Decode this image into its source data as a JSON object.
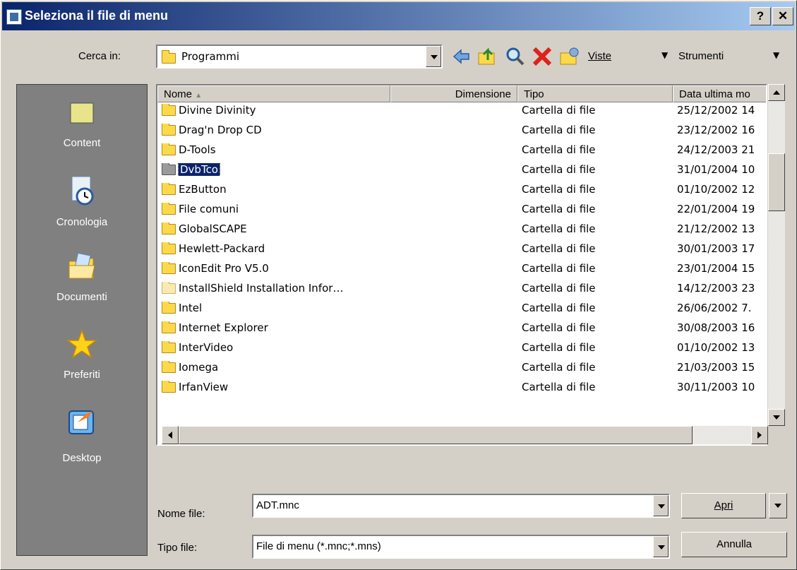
{
  "window": {
    "title": "Seleziona il file di menu",
    "help_label": "?",
    "close_label": "✕"
  },
  "toolbar": {
    "look_in_label": "Cerca in:",
    "look_in_value": "Programmi",
    "views_label": "Viste",
    "tools_label": "Strumenti"
  },
  "sidebar": {
    "items": [
      {
        "label": "Content",
        "icon": "folder-icon"
      },
      {
        "label": "Cronologia",
        "icon": "history-icon"
      },
      {
        "label": "Documenti",
        "icon": "documents-icon"
      },
      {
        "label": "Preferiti",
        "icon": "favorites-star-icon"
      },
      {
        "label": "Desktop",
        "icon": "desktop-icon"
      }
    ]
  },
  "list": {
    "columns": [
      "Nome",
      "Dimensione",
      "Tipo",
      "Data ultima mo"
    ],
    "rows": [
      {
        "name": "Divine Divinity",
        "size": "",
        "type": "Cartella di file",
        "date": "25/12/2002 14"
      },
      {
        "name": "Drag'n Drop CD",
        "size": "",
        "type": "Cartella di file",
        "date": "23/12/2002 16"
      },
      {
        "name": "D-Tools",
        "size": "",
        "type": "Cartella di file",
        "date": "24/12/2003 21"
      },
      {
        "name": "DvbTco",
        "size": "",
        "type": "Cartella di file",
        "date": "31/01/2004 10"
      },
      {
        "name": "EzButton",
        "size": "",
        "type": "Cartella di file",
        "date": "01/10/2002 12"
      },
      {
        "name": "File comuni",
        "size": "",
        "type": "Cartella di file",
        "date": "22/01/2004 19"
      },
      {
        "name": "GlobalSCAPE",
        "size": "",
        "type": "Cartella di file",
        "date": "21/12/2002 13"
      },
      {
        "name": "Hewlett-Packard",
        "size": "",
        "type": "Cartella di file",
        "date": "30/01/2003 17"
      },
      {
        "name": "IconEdit Pro V5.0",
        "size": "",
        "type": "Cartella di file",
        "date": "23/01/2004 15"
      },
      {
        "name": "InstallShield Installation Infor…",
        "size": "",
        "type": "Cartella di file",
        "date": "14/12/2003 23"
      },
      {
        "name": "Intel",
        "size": "",
        "type": "Cartella di file",
        "date": "26/06/2002 7."
      },
      {
        "name": "Internet Explorer",
        "size": "",
        "type": "Cartella di file",
        "date": "30/08/2003 16"
      },
      {
        "name": "InterVideo",
        "size": "",
        "type": "Cartella di file",
        "date": "01/10/2002 13"
      },
      {
        "name": "Iomega",
        "size": "",
        "type": "Cartella di file",
        "date": "21/03/2003 15"
      },
      {
        "name": "IrfanView",
        "size": "",
        "type": "Cartella di file",
        "date": "30/11/2003 10"
      }
    ],
    "selected_index": 3
  },
  "form": {
    "filename_label": "Nome file:",
    "filename_value": "ADT.mnc",
    "filetype_label": "Tipo file:",
    "filetype_value": "File di menu (*.mnc;*.mns)",
    "open_label": "Apri",
    "cancel_label": "Annulla"
  }
}
